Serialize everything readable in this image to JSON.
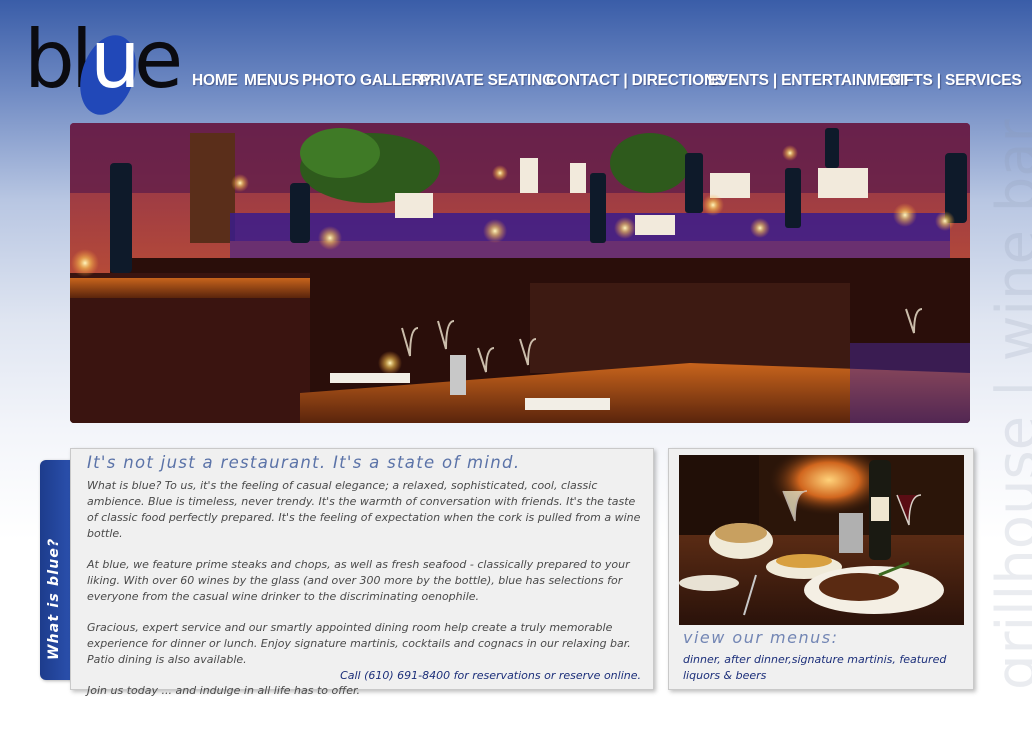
{
  "brand": {
    "logo_b": "bl",
    "logo_u": "u",
    "logo_e": "e"
  },
  "nav": {
    "items": [
      {
        "label": "HOME"
      },
      {
        "label": "MENUS"
      },
      {
        "label": "PHOTO GALLERY"
      },
      {
        "label": "PRIVATE SEATING"
      },
      {
        "label": "CONTACT | DIRECTIONS"
      },
      {
        "label": "EVENTS | ENTERTAINMENT"
      },
      {
        "label": "GIFTS | SERVICES"
      }
    ]
  },
  "watermark": "grillhouse | wine bar",
  "side_tab": "What is blue?",
  "about": {
    "title": "It's not just a restaurant. It's a state of mind.",
    "p1": "What is blue? To us, it's the feeling of casual elegance; a relaxed, sophisticated, cool, classic ambience. Blue is timeless, never trendy. It's the warmth of conversation with friends. It's the taste of classic food perfectly prepared. It's the feeling of expectation when the cork is pulled from a wine bottle.",
    "p2": "At blue, we feature prime steaks and chops, as well as fresh seafood - classically prepared to your liking. With over 60 wines by the glass (and over 300 more by the bottle), blue has selections for everyone from the casual wine drinker to the discriminating oenophile.",
    "p3": "Gracious, expert service and our smartly appointed dining room help create a truly memorable experience for dinner or lunch. Enjoy signature martinis, cocktails and cognacs in our relaxing bar. Patio dining is also available.",
    "p4": "Join us today ... and indulge in all life has to offer.",
    "call": "Call (610) 691-8400 for reservations or reserve online."
  },
  "menus": {
    "title": "view our menus:",
    "links": "dinner, after dinner,signature martinis, featured liquors & beers"
  }
}
